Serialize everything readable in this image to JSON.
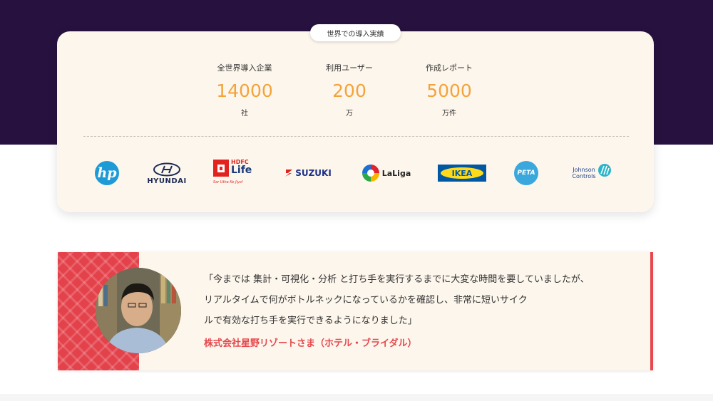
{
  "badge": {
    "label": "世界での導入実績"
  },
  "stats": [
    {
      "label": "全世界導入企業",
      "value": "14000",
      "unit": "社"
    },
    {
      "label": "利用ユーザー",
      "value": "200",
      "unit": "万"
    },
    {
      "label": "作成レポート",
      "value": "5000",
      "unit": "万件"
    }
  ],
  "logos": {
    "hp": "hp",
    "hyundai": "HYUNDAI",
    "hdfc_top": "HDFC",
    "hdfc_main": "Life",
    "hdfc_tagline": "Sar Utha Ke Jiyo!",
    "suzuki": "SUZUKI",
    "laliga": "LaLiga",
    "ikea": "IKEA",
    "peta": "PETA",
    "johnson_line1": "Johnson",
    "johnson_line2": "Controls"
  },
  "testimonial": {
    "quote_lines": [
      "「今までは 集計・可視化・分析 と打ち手を実行するまでに大変な時間を要していましたが、",
      "リアルタイムで何がボトルネックになっているかを確認し、非常に短いサイク",
      "ルで有効な打ち手を実行できるようになりました」"
    ],
    "author": "株式会社星野リゾートさま（ホテル・ブライダル）"
  },
  "colors": {
    "hero_bg": "#27123f",
    "accent_orange": "#f4a33a",
    "accent_red": "#e5484d",
    "card_bg": "#fdf6ec"
  }
}
